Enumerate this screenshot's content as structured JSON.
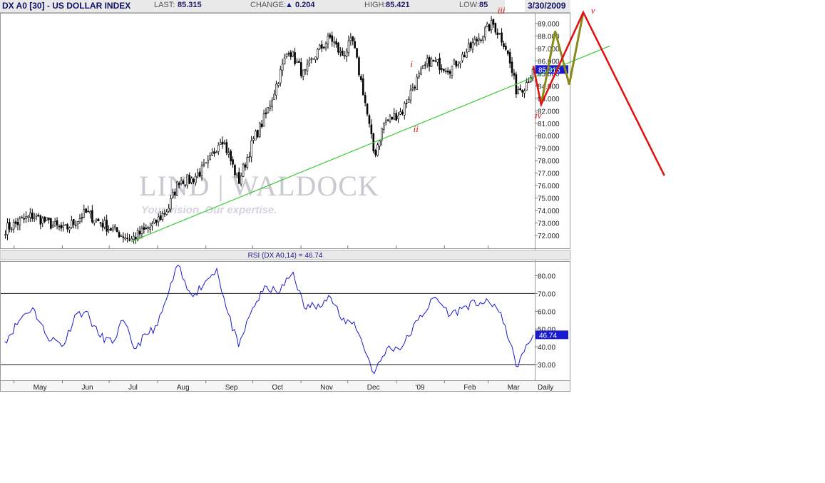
{
  "header": {
    "title": "DX A0 [30] - US DOLLAR INDEX",
    "last_label": "LAST:",
    "last_value": "85.315",
    "change_label": "CHANGE:",
    "change_value": "0.204",
    "high_label": "HIGH:",
    "high_value": "85.421",
    "low_label": "LOW:",
    "low_value": "85",
    "date": "3/30/2009"
  },
  "watermark": {
    "brand": "LIND | WALDOCK",
    "tagline": "Your vision. Our expertise."
  },
  "colors": {
    "price": "#000000",
    "trendline": "#33cc33",
    "forecast_red": "#e01010",
    "forecast_olive": "#8a8a1a",
    "rsi_line": "#1a1ad0",
    "tag_bg": "#1a1ad0",
    "grid": "#d6d6d6"
  },
  "chart_data": [
    {
      "type": "candlestick",
      "title": "DX A0 [30] - US DOLLAR INDEX",
      "frequency_label": "Daily",
      "last_tag": "85.315",
      "y_ticks": [
        "72.000",
        "73.000",
        "74.000",
        "75.000",
        "76.000",
        "77.000",
        "78.000",
        "79.000",
        "80.000",
        "81.000",
        "82.000",
        "83.000",
        "84.000",
        "85.000",
        "86.000",
        "87.000",
        "88.000",
        "89.000"
      ],
      "ylim": [
        71.0,
        89.8
      ],
      "x_ticks": [
        "May",
        "Jun",
        "Jul",
        "Aug",
        "Sep",
        "Oct",
        "Nov",
        "Dec",
        "'09",
        "Feb",
        "Mar",
        "Daily"
      ],
      "anchor_closes": [
        {
          "date": "2008-04-25",
          "close": 72.5
        },
        {
          "date": "2008-05-13",
          "close": 73.6
        },
        {
          "date": "2008-06-02",
          "close": 72.4
        },
        {
          "date": "2008-06-16",
          "close": 73.8
        },
        {
          "date": "2008-07-01",
          "close": 72.6
        },
        {
          "date": "2008-07-15",
          "close": 71.7
        },
        {
          "date": "2008-07-29",
          "close": 72.8
        },
        {
          "date": "2008-08-08",
          "close": 74.2
        },
        {
          "date": "2008-08-15",
          "close": 76.5
        },
        {
          "date": "2008-08-22",
          "close": 76.4
        },
        {
          "date": "2008-09-02",
          "close": 77.6
        },
        {
          "date": "2008-09-11",
          "close": 80.0
        },
        {
          "date": "2008-09-22",
          "close": 76.3
        },
        {
          "date": "2008-10-01",
          "close": 79.5
        },
        {
          "date": "2008-10-10",
          "close": 81.8
        },
        {
          "date": "2008-10-24",
          "close": 87.0
        },
        {
          "date": "2008-11-03",
          "close": 84.8
        },
        {
          "date": "2008-11-10",
          "close": 86.5
        },
        {
          "date": "2008-11-20",
          "close": 87.9
        },
        {
          "date": "2008-11-27",
          "close": 86.4
        },
        {
          "date": "2008-12-04",
          "close": 87.6
        },
        {
          "date": "2008-12-11",
          "close": 83.5
        },
        {
          "date": "2008-12-18",
          "close": 78.4
        },
        {
          "date": "2008-12-24",
          "close": 81.0
        },
        {
          "date": "2009-01-05",
          "close": 82.0
        },
        {
          "date": "2009-01-12",
          "close": 84.0
        },
        {
          "date": "2009-01-22",
          "close": 86.0
        },
        {
          "date": "2009-02-05",
          "close": 85.4
        },
        {
          "date": "2009-02-12",
          "close": 86.3
        },
        {
          "date": "2009-02-24",
          "close": 88.0
        },
        {
          "date": "2009-03-04",
          "close": 89.0
        },
        {
          "date": "2009-03-12",
          "close": 87.3
        },
        {
          "date": "2009-03-19",
          "close": 83.7
        },
        {
          "date": "2009-03-24",
          "close": 84.0
        },
        {
          "date": "2009-03-30",
          "close": 85.315
        }
      ],
      "trendline": [
        {
          "date": "2008-07-15",
          "value": 71.5
        },
        {
          "date": "2009-05-18",
          "value": 87.2
        }
      ],
      "wave_labels": [
        {
          "label": "i",
          "date": "2009-01-10",
          "value": 85.5
        },
        {
          "label": "ii",
          "date": "2009-01-12",
          "value": 80.3
        },
        {
          "label": "iii",
          "date": "2009-03-07",
          "value": 89.8
        },
        {
          "label": "iv",
          "date": "2009-03-31",
          "value": 81.4
        }
      ],
      "forecast_red": [
        {
          "date": "2009-03-30",
          "value": 85.6
        },
        {
          "date": "2009-04-04",
          "value": 82.5
        },
        {
          "date": "2009-05-01",
          "value": 89.9
        },
        {
          "date": "2009-06-22",
          "value": 76.8
        }
      ],
      "forecast_red_label": {
        "label": "v",
        "date": "2009-05-06",
        "value": 89.8
      },
      "forecast_olive": [
        {
          "date": "2009-04-04",
          "value": 82.5
        },
        {
          "date": "2009-04-13",
          "value": 88.4
        },
        {
          "date": "2009-04-22",
          "value": 84.1
        },
        {
          "date": "2009-05-01",
          "value": 89.9
        }
      ]
    },
    {
      "type": "line",
      "title": "RSI (DX A0,14) = 46.74",
      "last_tag": "46.74",
      "y_ticks": [
        "30.00",
        "40.00",
        "50.00",
        "60.00",
        "70.00",
        "80.00"
      ],
      "ylim": [
        22,
        88
      ],
      "reference_lines": [
        70,
        30
      ],
      "points": [
        {
          "date": "2008-04-25",
          "value": 43
        },
        {
          "date": "2008-05-07",
          "value": 58
        },
        {
          "date": "2008-05-13",
          "value": 62
        },
        {
          "date": "2008-05-22",
          "value": 46
        },
        {
          "date": "2008-06-02",
          "value": 41
        },
        {
          "date": "2008-06-09",
          "value": 58
        },
        {
          "date": "2008-06-16",
          "value": 60
        },
        {
          "date": "2008-06-24",
          "value": 47
        },
        {
          "date": "2008-07-03",
          "value": 42
        },
        {
          "date": "2008-07-10",
          "value": 55
        },
        {
          "date": "2008-07-17",
          "value": 39
        },
        {
          "date": "2008-07-25",
          "value": 47
        },
        {
          "date": "2008-08-01",
          "value": 52
        },
        {
          "date": "2008-08-08",
          "value": 70
        },
        {
          "date": "2008-08-14",
          "value": 86
        },
        {
          "date": "2008-08-20",
          "value": 72
        },
        {
          "date": "2008-08-25",
          "value": 70
        },
        {
          "date": "2008-09-02",
          "value": 78
        },
        {
          "date": "2008-09-08",
          "value": 84
        },
        {
          "date": "2008-09-14",
          "value": 62
        },
        {
          "date": "2008-09-22",
          "value": 40
        },
        {
          "date": "2008-10-01",
          "value": 62
        },
        {
          "date": "2008-10-10",
          "value": 74
        },
        {
          "date": "2008-10-17",
          "value": 70
        },
        {
          "date": "2008-10-27",
          "value": 82
        },
        {
          "date": "2008-11-03",
          "value": 62
        },
        {
          "date": "2008-11-12",
          "value": 64
        },
        {
          "date": "2008-11-20",
          "value": 68
        },
        {
          "date": "2008-11-27",
          "value": 55
        },
        {
          "date": "2008-12-05",
          "value": 54
        },
        {
          "date": "2008-12-18",
          "value": 25
        },
        {
          "date": "2008-12-26",
          "value": 39
        },
        {
          "date": "2009-01-05",
          "value": 40
        },
        {
          "date": "2009-01-15",
          "value": 55
        },
        {
          "date": "2009-01-26",
          "value": 68
        },
        {
          "date": "2009-02-05",
          "value": 58
        },
        {
          "date": "2009-02-15",
          "value": 63
        },
        {
          "date": "2009-02-24",
          "value": 65
        },
        {
          "date": "2009-03-05",
          "value": 64
        },
        {
          "date": "2009-03-12",
          "value": 52
        },
        {
          "date": "2009-03-19",
          "value": 29
        },
        {
          "date": "2009-03-24",
          "value": 37
        },
        {
          "date": "2009-03-30",
          "value": 46.74
        }
      ]
    }
  ]
}
